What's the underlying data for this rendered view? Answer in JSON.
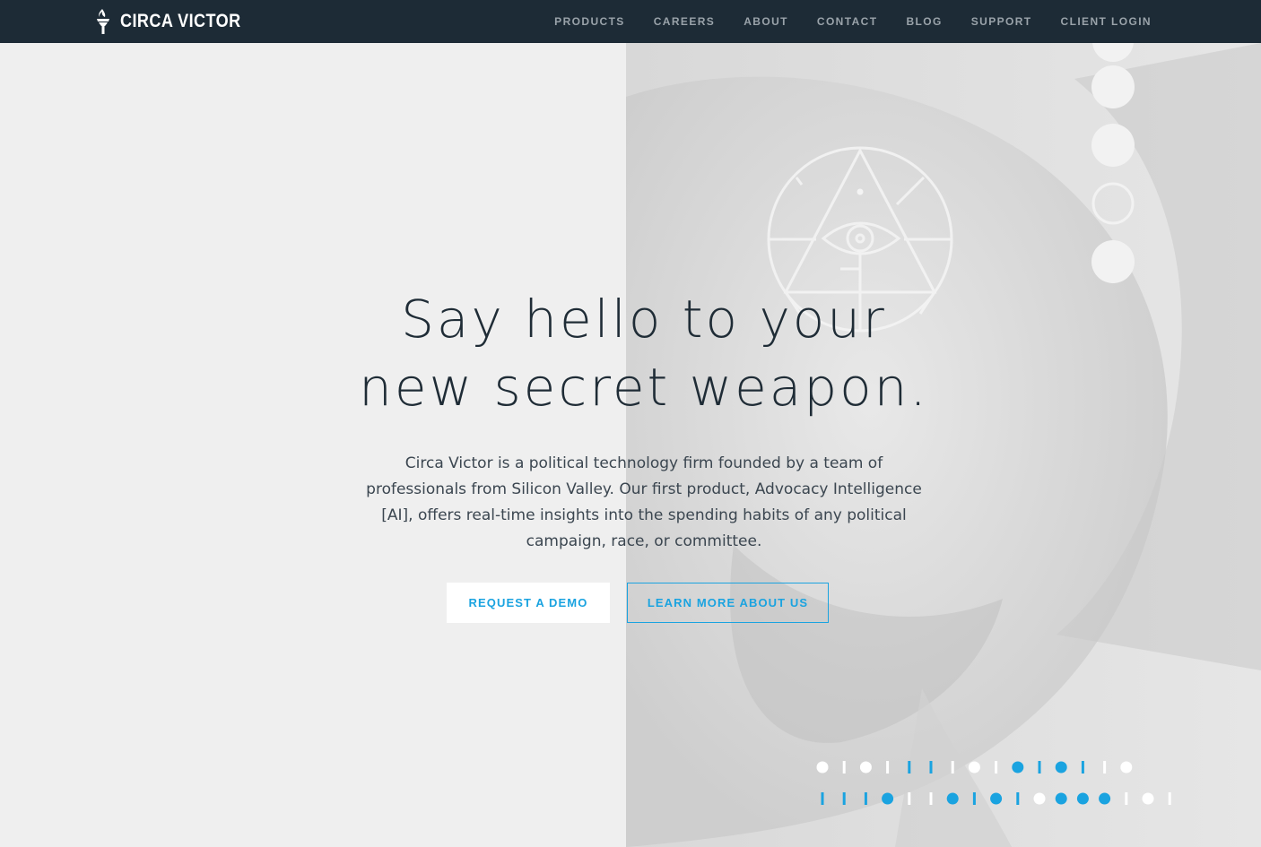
{
  "brand": {
    "name": "CIRCA VICTOR",
    "icon": "torch-icon"
  },
  "nav": {
    "items": [
      {
        "label": "PRODUCTS"
      },
      {
        "label": "CAREERS"
      },
      {
        "label": "ABOUT"
      },
      {
        "label": "CONTACT"
      },
      {
        "label": "BLOG"
      },
      {
        "label": "SUPPORT"
      },
      {
        "label": "CLIENT LOGIN"
      }
    ]
  },
  "hero": {
    "title_line1": "Say hello to your",
    "title_line2": "new secret weapon.",
    "body": "Circa Victor is a political technology firm founded by a team of professionals from Silicon Valley. Our first product, Advocacy Intelligence [AI], offers real-time insights into the spending habits of any political campaign, race, or committee.",
    "primary_cta": "REQUEST A DEMO",
    "secondary_cta": "LEARN MORE ABOUT US",
    "emblem_icon": "all-seeing-eye-icon"
  },
  "colors": {
    "navbar": "#1d2b36",
    "accent": "#1aa3e0",
    "background": "#efefef",
    "text": "#1f2c36"
  },
  "decor": {
    "dot_row_1": [
      "w-dot",
      "w-bar",
      "w-dot",
      "w-bar",
      "b-bar",
      "b-bar",
      "w-bar",
      "w-dot",
      "w-bar",
      "b-dot",
      "b-bar",
      "b-dot",
      "b-bar",
      "w-bar",
      "w-dot"
    ],
    "dot_row_2": [
      "b-bar",
      "b-bar",
      "b-bar",
      "b-dot",
      "w-bar",
      "w-bar",
      "b-dot",
      "b-bar",
      "b-dot",
      "b-bar",
      "w-dot",
      "b-dot",
      "b-dot",
      "b-dot",
      "w-bar",
      "w-dot",
      "w-bar"
    ]
  }
}
